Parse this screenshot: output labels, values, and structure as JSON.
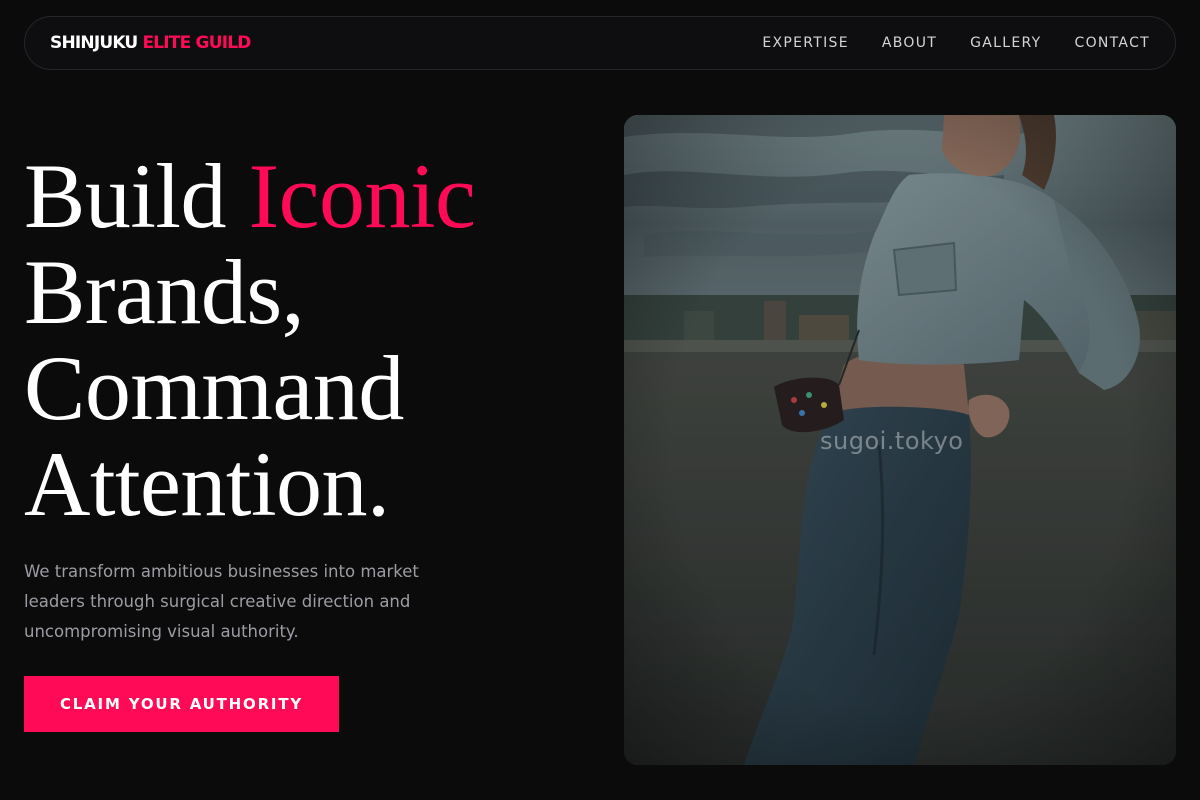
{
  "brand": {
    "name_part1": "SHINJUKU",
    "name_part2": "ELITE GUILD",
    "accent_color": "#ff0a56"
  },
  "nav": {
    "links": [
      {
        "label": "EXPERTISE"
      },
      {
        "label": "ABOUT"
      },
      {
        "label": "GALLERY"
      },
      {
        "label": "CONTACT"
      }
    ]
  },
  "hero": {
    "headline": {
      "line1_word1": "Build",
      "line1_word2": "Iconic",
      "line2": "Brands,",
      "line3": "Command",
      "line4": "Attention."
    },
    "subtext": "We transform ambitious businesses into market leaders through surgical creative direction and uncompromising visual authority.",
    "cta_label": "CLAIM YOUR AUTHORITY",
    "image": {
      "subject": "woman-in-denim-jacket-leaning-on-concrete-wall",
      "watermark": "sugoi.tokyo"
    }
  }
}
